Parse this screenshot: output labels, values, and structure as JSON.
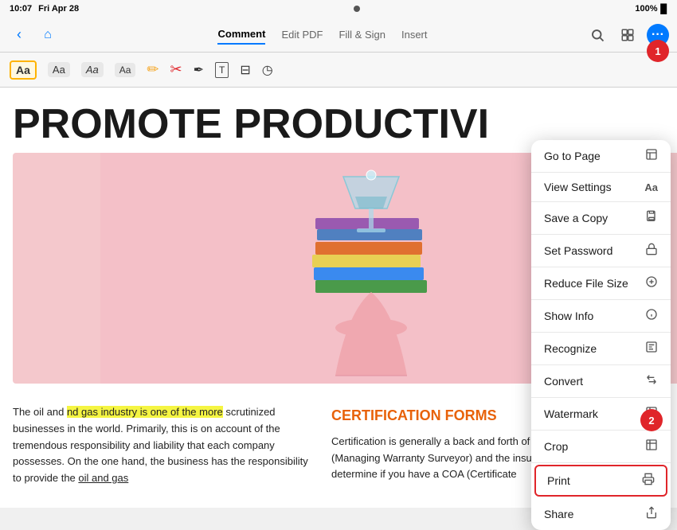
{
  "statusBar": {
    "time": "10:07",
    "day": "Fri Apr 28",
    "battery": "100%",
    "batteryIcon": "🔋"
  },
  "toolbar": {
    "tabs": [
      {
        "id": "comment",
        "label": "Comment",
        "active": true
      },
      {
        "id": "editPdf",
        "label": "Edit PDF",
        "active": false
      },
      {
        "id": "fillSign",
        "label": "Fill & Sign",
        "active": false
      },
      {
        "id": "insert",
        "label": "Insert",
        "active": false
      }
    ]
  },
  "annotationBar": {
    "buttons": [
      {
        "id": "font1",
        "label": "Aa",
        "style": "normal"
      },
      {
        "id": "font2",
        "label": "Aa",
        "style": "normal"
      },
      {
        "id": "font3",
        "label": "Aa",
        "style": "normal"
      },
      {
        "id": "font4",
        "label": "Aa",
        "style": "normal"
      }
    ]
  },
  "pdfContent": {
    "title": "PROMOTE PRODUCTIVI",
    "leftText": "The oil and gas industry is one of the more scrutinized businesses in the world. Primarily, this is on account of the tremendous responsibility and liability that each company possesses. On the one hand, the business has the responsibility to provide the oil and gas",
    "highlightedPhrase": "nd gas industry is one of the more",
    "certTitle": "CERTIFICATION FORMS",
    "certText": "Certification is generally a back and forth of fixes between the MWS (Managing Warranty Surveyor) and the insurer. Since the MWS will determine if you have a COA (Certificate"
  },
  "dropdownMenu": {
    "items": [
      {
        "id": "goto",
        "label": "Go to Page",
        "icon": "⬜"
      },
      {
        "id": "viewSettings",
        "label": "View Settings",
        "icon": "Aa"
      },
      {
        "id": "saveCopy",
        "label": "Save a Copy",
        "icon": "📋"
      },
      {
        "id": "setPassword",
        "label": "Set Password",
        "icon": "🔒"
      },
      {
        "id": "reduceFileSize",
        "label": "Reduce File Size",
        "icon": "⊕"
      },
      {
        "id": "showInfo",
        "label": "Show Info",
        "icon": "ℹ"
      },
      {
        "id": "recognize",
        "label": "Recognize",
        "icon": "⬜"
      },
      {
        "id": "convert",
        "label": "Convert",
        "icon": "⇄"
      },
      {
        "id": "watermark",
        "label": "Watermark",
        "icon": "⬜"
      },
      {
        "id": "crop",
        "label": "Crop",
        "icon": "⬜"
      },
      {
        "id": "print",
        "label": "Print",
        "icon": "🖨",
        "highlighted": true
      },
      {
        "id": "share",
        "label": "Share",
        "icon": "⬆"
      }
    ]
  },
  "steps": {
    "step1Label": "1",
    "step2Label": "2"
  },
  "colors": {
    "accent": "#007aff",
    "danger": "#e0252a",
    "highlight": "#f5f542",
    "certTitleColor": "#e8620a"
  }
}
